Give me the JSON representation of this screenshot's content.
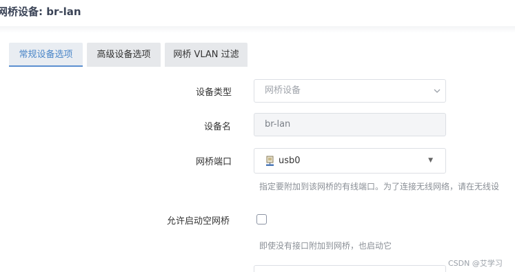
{
  "page": {
    "title": "网桥设备: br-lan"
  },
  "tabs": [
    {
      "label": "常规设备选项",
      "active": true
    },
    {
      "label": "高级设备选项",
      "active": false
    },
    {
      "label": "网桥 VLAN 过滤",
      "active": false
    }
  ],
  "form": {
    "device_type": {
      "label": "设备类型",
      "value": "网桥设备"
    },
    "device_name": {
      "label": "设备名",
      "value": "br-lan"
    },
    "bridge_ports": {
      "label": "网桥端口",
      "value": "usb0",
      "icon": "ethernet-port-icon",
      "hint": "指定要附加到该网桥的有线端口。为了连接无线网络，请在无线设"
    },
    "bring_up_empty": {
      "label": "允许启动空网桥",
      "checked": false,
      "hint": "即使没有接口附加到网桥，也启动它"
    }
  },
  "watermark": "CSDN @艾学习",
  "colors": {
    "accent": "#5b8fd0",
    "tab_bg": "#e6e8eb",
    "readonly_bg": "#f4f5f7",
    "border": "#dcdfe4"
  }
}
